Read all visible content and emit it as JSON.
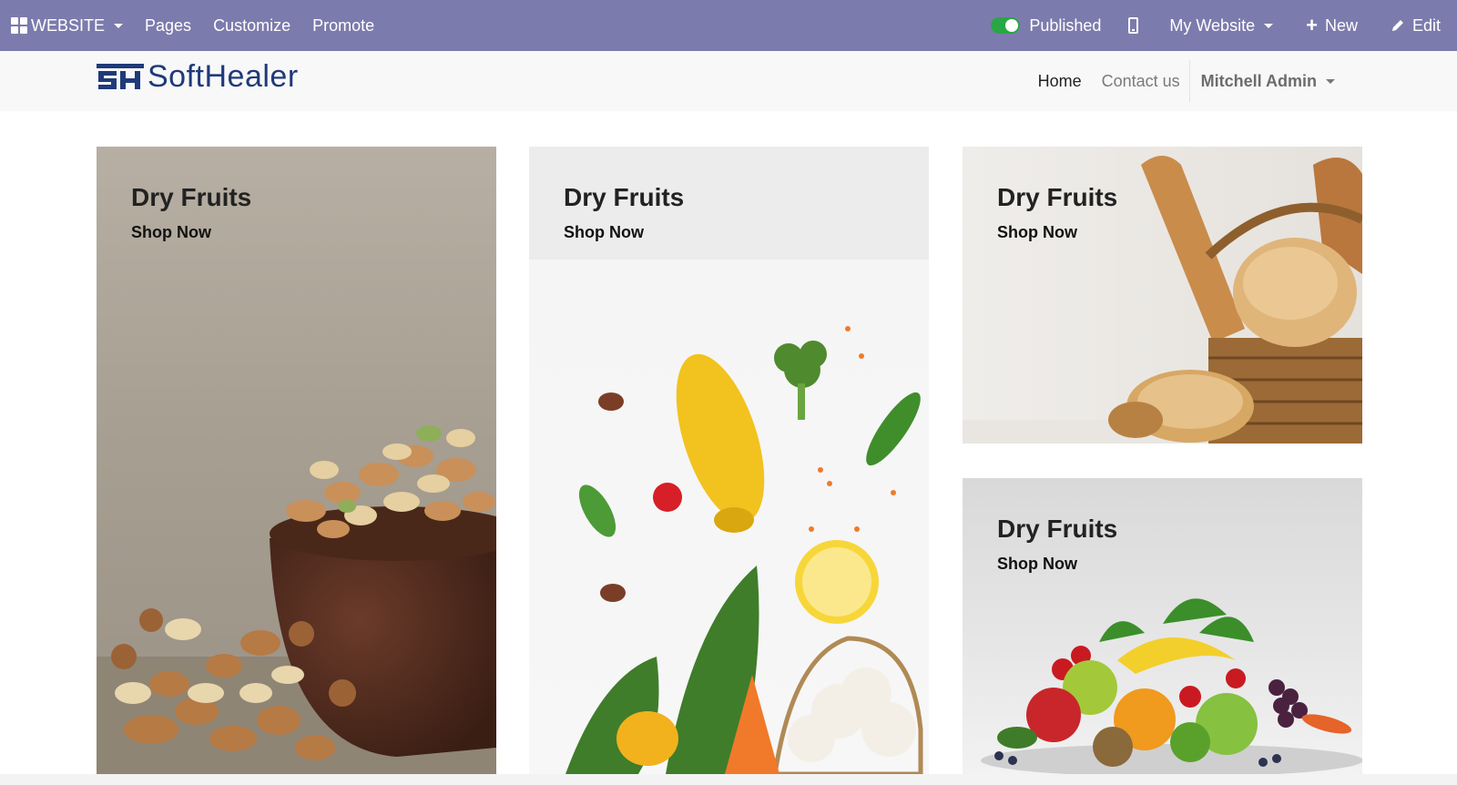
{
  "adminbar": {
    "app_label": "WEBSITE",
    "menu": [
      "Pages",
      "Customize",
      "Promote"
    ],
    "published_label": "Published",
    "website_label": "My Website",
    "new_label": "New",
    "edit_label": "Edit",
    "published": true,
    "colors": {
      "bar": "#7c7bad",
      "toggle_on": "#28a745"
    }
  },
  "header": {
    "logo_text": "SoftHealer",
    "nav": {
      "home": "Home",
      "contact": "Contact us",
      "user": "Mitchell Admin"
    }
  },
  "cards": [
    {
      "title": "Dry Fruits",
      "cta": "Shop Now",
      "image": "nuts-in-bowl"
    },
    {
      "title": "Dry Fruits",
      "cta": "Shop Now",
      "image": "vegetables-flatlay"
    },
    {
      "title": "Dry Fruits",
      "cta": "Shop Now",
      "image": "bread-basket"
    },
    {
      "title": "Dry Fruits",
      "cta": "Shop Now",
      "image": "fruit-pile"
    }
  ],
  "icons": {
    "app": "apps-grid-icon",
    "device": "mobile-icon",
    "new": "plus-icon",
    "edit": "pencil-icon"
  }
}
